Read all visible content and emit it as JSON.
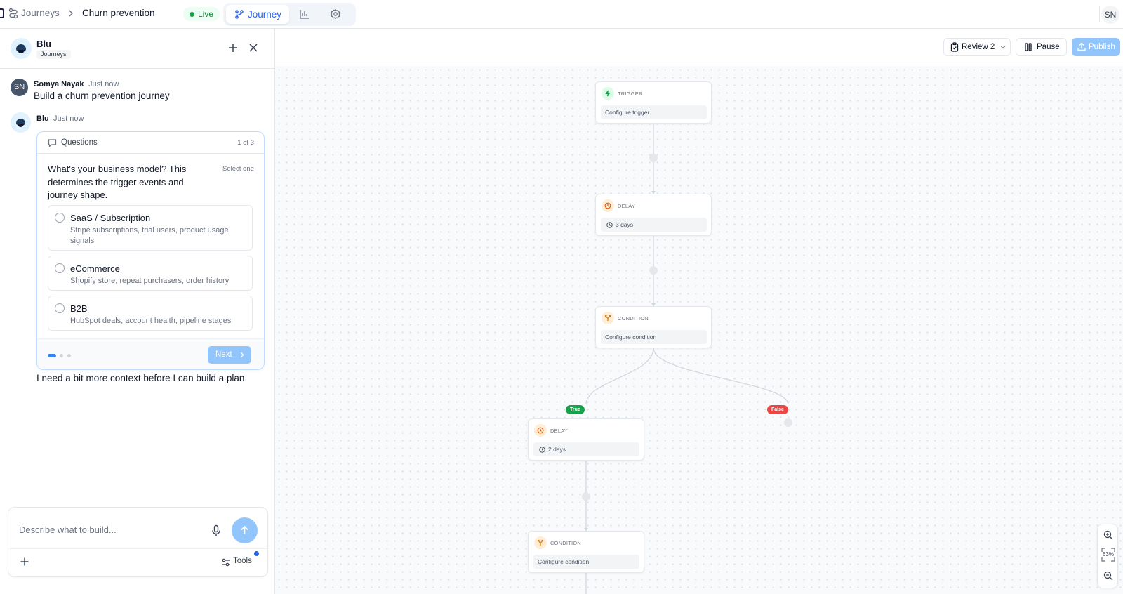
{
  "topbar": {
    "breadcrumb_root": "Journeys",
    "breadcrumb_current": "Churn prevention",
    "status": "Live",
    "tabs": {
      "journey": "Journey"
    },
    "user_initials": "SN"
  },
  "chat": {
    "bot_name": "Blu",
    "bot_tag": "Journeys",
    "messages": [
      {
        "author": "Somya Nayak",
        "initials": "SN",
        "time": "Just now",
        "text": "Build a churn prevention journey"
      },
      {
        "author": "Blu",
        "time": "Just now",
        "text": "I need a bit more context before I can build a plan."
      }
    ],
    "question_card": {
      "title": "Questions",
      "count": "1 of 3",
      "question": "What's your business model? This determines the trigger events and journey shape.",
      "hint": "Select one",
      "options": [
        {
          "title": "SaaS / Subscription",
          "desc": "Stripe subscriptions, trial users, product usage signals"
        },
        {
          "title": "eCommerce",
          "desc": "Shopify store, repeat purchasers, order history"
        },
        {
          "title": "B2B",
          "desc": "HubSpot deals, account health, pipeline stages"
        }
      ],
      "next_label": "Next",
      "step": 1,
      "steps_total": 3
    },
    "composer": {
      "placeholder": "Describe what to build...",
      "tools_label": "Tools"
    }
  },
  "canvas": {
    "toolbar": {
      "review_label": "Review 2",
      "pause_label": "Pause",
      "publish_label": "Publish"
    },
    "nodes": [
      {
        "type": "TRIGGER",
        "body": "Configure trigger"
      },
      {
        "type": "DELAY",
        "body": "3 days"
      },
      {
        "type": "CONDITION",
        "body": "Configure condition"
      },
      {
        "type": "DELAY",
        "body": "2 days"
      },
      {
        "type": "CONDITION",
        "body": "Configure condition"
      }
    ],
    "branches": {
      "true_label": "True",
      "false_label": "False"
    },
    "zoom": "63%"
  },
  "colors": {
    "accent": "#3b82f6",
    "accent_light": "#93c5fd",
    "live_green": "#16a34a",
    "true_green": "#16a34a",
    "false_red": "#ef4444"
  }
}
